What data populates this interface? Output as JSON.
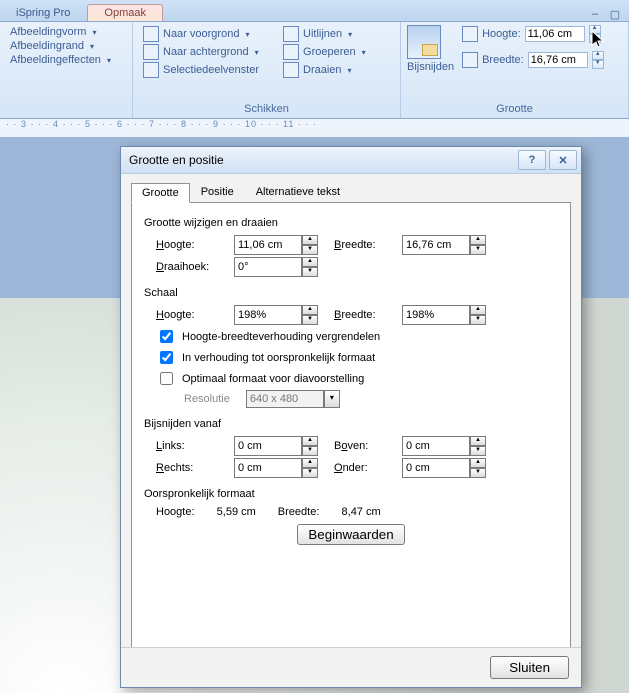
{
  "ribbon": {
    "tabs": {
      "ispring": "iSpring Pro",
      "opmaak": "Opmaak"
    },
    "group_image": {
      "shape": "Afbeeldingvorm",
      "border": "Afbeeldingrand",
      "effects": "Afbeeldingeffecten"
    },
    "group_arrange": {
      "front": "Naar voorgrond",
      "back": "Naar achtergrond",
      "selpane": "Selectiedeelvenster",
      "align": "Uitlijnen",
      "group": "Groeperen",
      "rotate": "Draaien",
      "title": "Schikken"
    },
    "group_size": {
      "crop": "Bijsnijden",
      "height_label": "Hoogte:",
      "width_label": "Breedte:",
      "height_val": "11,06 cm",
      "width_val": "16,76 cm",
      "title": "Grootte"
    }
  },
  "ruler": "· · 3 · · · 4 · · · 5 · · · 6 · · · 7 · · · 8 · · · 9 · · · 10 · · · 11 · · ·",
  "dialog": {
    "title": "Grootte en positie",
    "tabs": {
      "size": "Grootte",
      "pos": "Positie",
      "alt": "Alternatieve tekst"
    },
    "sec_resize": "Grootte wijzigen en draaien",
    "height_label": "Hoogte:",
    "width_label": "Breedte:",
    "height_val": "11,06 cm",
    "width_val": "16,76 cm",
    "rotation_label": "Draaihoek:",
    "rotation_val": "0°",
    "sec_scale": "Schaal",
    "scale_h": "198%",
    "scale_w": "198%",
    "lock": "Hoogte-breedteverhouding vergrendelen",
    "orig": "In verhouding tot oorspronkelijk formaat",
    "best": "Optimaal formaat voor diavoorstelling",
    "res_label": "Resolutie",
    "res_val": "640 x 480",
    "sec_crop": "Bijsnijden vanaf",
    "crop_left_l": "Links:",
    "crop_right_l": "Rechts:",
    "crop_top_l": "Boven:",
    "crop_bottom_l": "Onder:",
    "crop_val": "0 cm",
    "sec_orig": "Oorspronkelijk formaat",
    "orig_h": "5,59 cm",
    "orig_w": "8,47 cm",
    "reset": "Beginwaarden",
    "close": "Sluiten"
  }
}
